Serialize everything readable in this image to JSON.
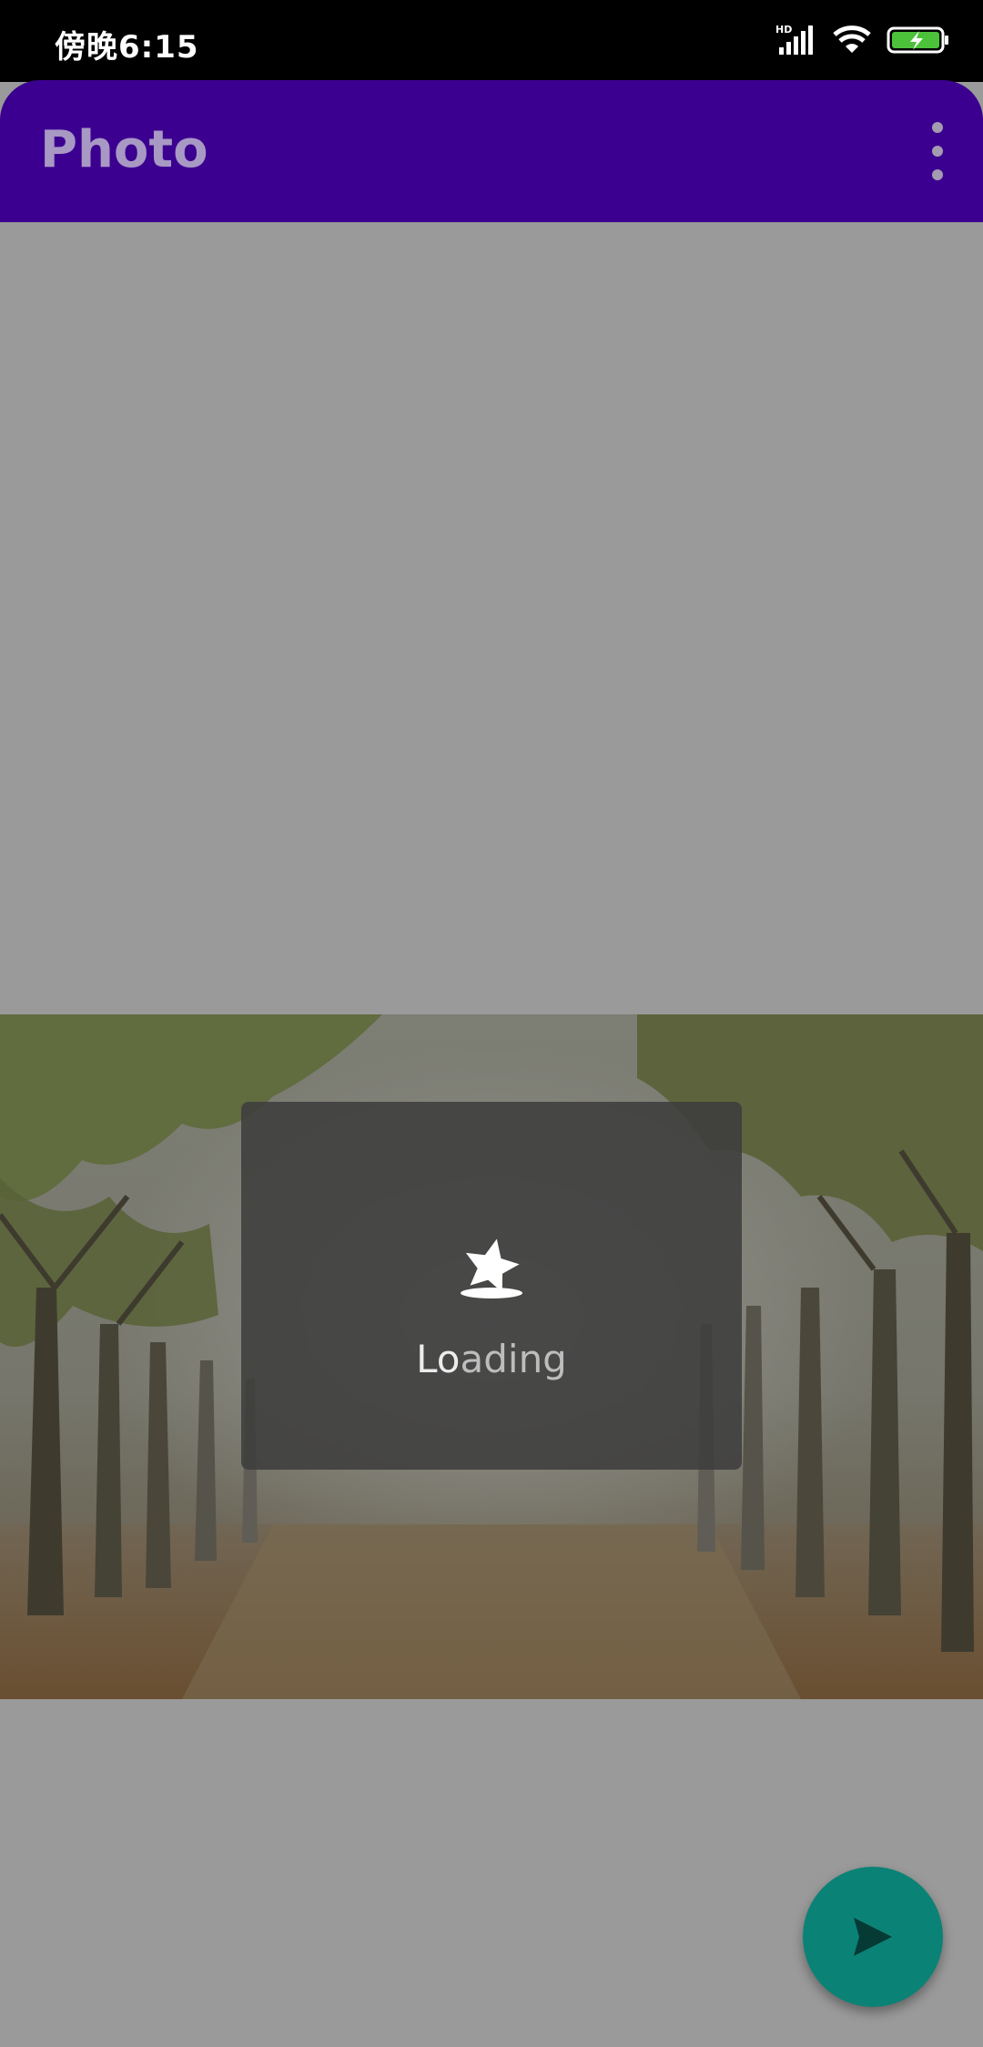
{
  "status_bar": {
    "time": "傍晚6:15",
    "network_badge": "HD",
    "icons": [
      "signal-icon",
      "wifi-icon",
      "battery-charging-icon"
    ]
  },
  "app_bar": {
    "title": "Photo",
    "overflow_icon": "more-vert-icon"
  },
  "loading": {
    "text_highlight": "Lo",
    "text_rest": "ading",
    "icon": "star-icon"
  },
  "fab": {
    "icon": "send-icon"
  },
  "colors": {
    "app_bar": "#3c0090",
    "scrim_background": "#9a9a9a",
    "fab": "#0b8276",
    "dialog": "#3e3e3e"
  }
}
